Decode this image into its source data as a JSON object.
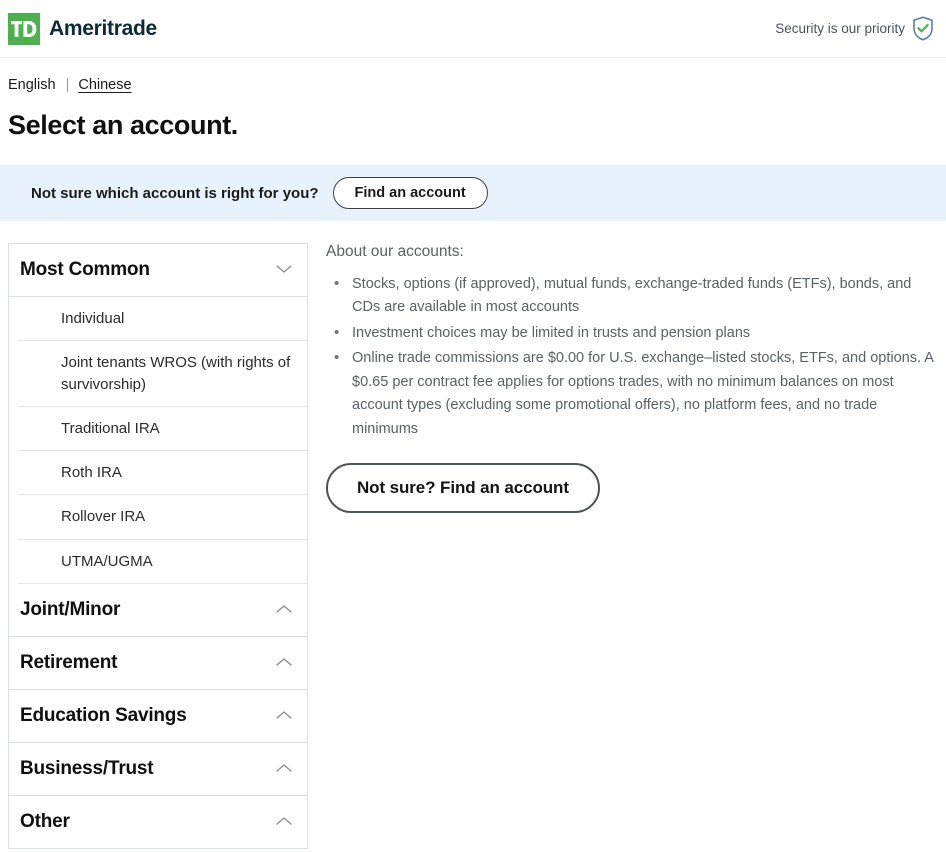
{
  "header": {
    "logo_mark": "td-logo-icon",
    "brand_name": "Ameritrade",
    "security_text": "Security is our priority",
    "security_icon": "shield-check-icon",
    "brand_green": "#4cb14c"
  },
  "language": {
    "english_label": "English",
    "separator": "|",
    "chinese_label": "Chinese"
  },
  "page": {
    "title": "Select an account."
  },
  "banner": {
    "prompt": "Not sure which account is right for you?",
    "button_label": "Find an account",
    "background_color": "#e8f2fd"
  },
  "accordion": {
    "sections": [
      {
        "label": "Most Common",
        "icon": "chevron-down-icon",
        "expanded": true,
        "items": [
          "Individual",
          "Joint tenants WROS (with rights of survivorship)",
          "Traditional IRA",
          "Roth IRA",
          "Rollover IRA",
          "UTMA/UGMA"
        ]
      },
      {
        "label": "Joint/Minor",
        "icon": "chevron-up-icon",
        "expanded": false,
        "items": []
      },
      {
        "label": "Retirement",
        "icon": "chevron-up-icon",
        "expanded": false,
        "items": []
      },
      {
        "label": "Education Savings",
        "icon": "chevron-up-icon",
        "expanded": false,
        "items": []
      },
      {
        "label": "Business/Trust",
        "icon": "chevron-up-icon",
        "expanded": false,
        "items": []
      },
      {
        "label": "Other",
        "icon": "chevron-up-icon",
        "expanded": false,
        "items": []
      }
    ]
  },
  "about": {
    "heading": "About our accounts:",
    "bullets": [
      "Stocks, options (if approved), mutual funds, exchange-traded funds (ETFs), bonds, and CDs are available in most accounts",
      "Investment choices may be limited in trusts and pension plans",
      "Online trade commissions are $0.00 for U.S. exchange–listed stocks, ETFs, and options. A $0.65 per contract fee applies for options trades, with no minimum balances on most account types (excluding some promotional offers), no platform fees, and no trade minimums"
    ],
    "cta_label": "Not sure? Find an account"
  }
}
